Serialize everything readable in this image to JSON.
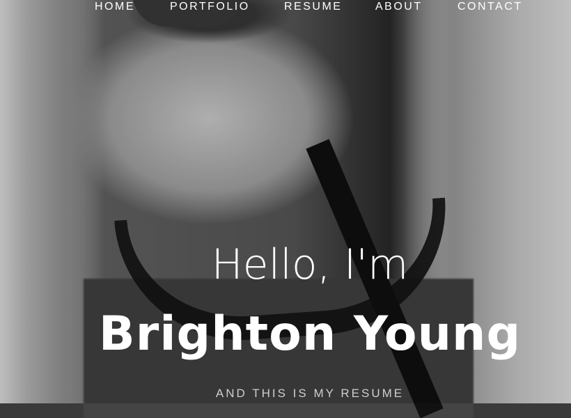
{
  "nav": {
    "items": [
      {
        "label": "HOME"
      },
      {
        "label": "PORTFOLIO"
      },
      {
        "label": "RESUME"
      },
      {
        "label": "ABOUT"
      },
      {
        "label": "CONTACT"
      }
    ]
  },
  "hero": {
    "greeting": "Hello, I'm",
    "name": "Brighton Young",
    "tagline": "AND THIS IS MY RESUME"
  },
  "colors": {
    "text": "#ffffff",
    "tagline": "#cfcfcf"
  }
}
